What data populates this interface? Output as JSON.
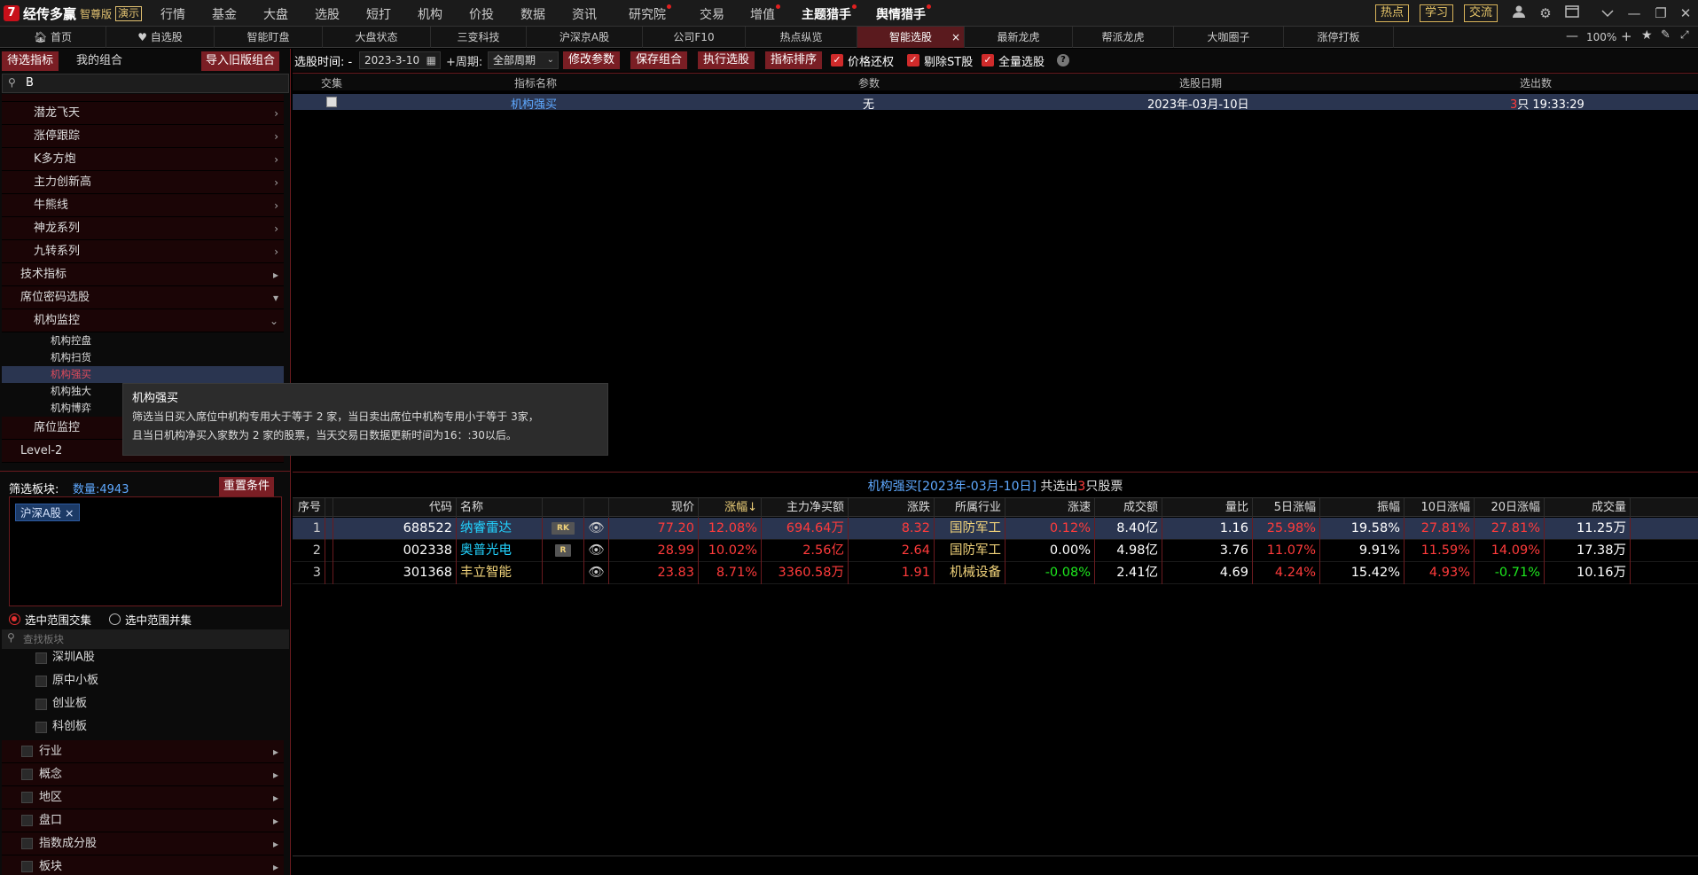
{
  "app": {
    "logo_mark": "7",
    "name": "经传多赢",
    "edition": "智尊版",
    "demo": "演示"
  },
  "top_menu": [
    "行情",
    "基金",
    "大盘",
    "选股",
    "短打",
    "机构",
    "价投",
    "数据",
    "资讯",
    "研究院",
    "交易",
    "增值",
    "主题猎手",
    "舆情猎手"
  ],
  "top_buttons": [
    "热点",
    "学习",
    "交流"
  ],
  "tabs": [
    "首页",
    "自选股",
    "智能盯盘",
    "大盘状态",
    "三变科技",
    "沪深京A股",
    "公司F10",
    "热点纵览",
    "智能选股",
    "最新龙虎",
    "帮派龙虎",
    "大咖圈子",
    "涨停打板"
  ],
  "zoom": "100%",
  "left_panel": {
    "tab_pending": "待选指标",
    "tab_mine": "我的组合",
    "import_btn": "导入旧版组合",
    "search_value": "B",
    "tree_top": [
      "潜龙飞天",
      "涨停跟踪",
      "K多方炮",
      "主力创新高",
      "牛熊线",
      "神龙系列",
      "九转系列"
    ],
    "tech": "技术指标",
    "seat_code": "席位密码选股",
    "inst_monitor": "机构监控",
    "inst_items": [
      "机构控盘",
      "机构扫货",
      "机构强买",
      "机构独大",
      "机构博弈"
    ],
    "seat_monitor": "席位监控",
    "level2": "Level-2",
    "filter_label": "筛选板块:",
    "count_label": "数量:4943",
    "reset_btn": "重置条件",
    "chip": "沪深A股",
    "radio_intersect": "选中范围交集",
    "radio_union": "选中范围并集",
    "board_search_placeholder": "查找板块",
    "boards": [
      "深圳A股",
      "原中小板",
      "创业板",
      "科创板"
    ],
    "categories": [
      "行业",
      "概念",
      "地区",
      "盘口",
      "指数成分股",
      "板块"
    ]
  },
  "tooltip": {
    "title": "机构强买",
    "line1": "筛选当日买入席位中机构专用大于等于 2 家，当日卖出席位中机构专用小于等于 3家，",
    "line2": "且当日机构净买入家数为 2 家的股票，当天交易日数据更新时间为16：:30以后。"
  },
  "controls": {
    "time_label": "选股时间: -",
    "date": "2023-3-10",
    "period_label": "+周期:",
    "period_value": "全部周期",
    "btn_modify": "修改参数",
    "btn_save": "保存组合",
    "btn_execute": "执行选股",
    "btn_sort": "指标排序",
    "chk_price": "价格还权",
    "chk_st": "剔除ST股",
    "chk_all": "全量选股",
    "help": "?"
  },
  "upper_table": {
    "headers": [
      "交集",
      "指标名称",
      "参数",
      "选股日期",
      "选出数"
    ],
    "row": {
      "name": "机构强买",
      "param": "无",
      "date": "2023年-03月-10日",
      "count": "3",
      "count_tail": "只 19:33:29"
    }
  },
  "result": {
    "title": "机构强买[2023年-03月-10日]",
    "mid": "共选出",
    "count": "3",
    "tail": "只股票"
  },
  "table_headers": [
    "序号",
    "代码",
    "名称",
    "",
    "",
    "现价",
    "涨幅↓",
    "主力净买额",
    "涨跌",
    "所属行业",
    "涨速",
    "成交额",
    "量比",
    "5日涨幅",
    "振幅",
    "10日涨幅",
    "20日涨幅",
    "成交量"
  ],
  "rows": [
    {
      "idx": "1",
      "code": "688522",
      "name": "纳睿雷达",
      "badge": "RK",
      "price": "77.20",
      "chg": "12.08%",
      "net": "694.64万",
      "up": "8.32",
      "ind": "国防军工",
      "speed": "0.12%",
      "amt": "8.40亿",
      "vr": "1.16",
      "d5": "25.98%",
      "amp": "19.58%",
      "d10": "27.81%",
      "d20": "27.81%",
      "vol": "11.25万"
    },
    {
      "idx": "2",
      "code": "002338",
      "name": "奥普光电",
      "badge": "R",
      "price": "28.99",
      "chg": "10.02%",
      "net": "2.56亿",
      "up": "2.64",
      "ind": "国防军工",
      "speed": "0.00%",
      "amt": "4.98亿",
      "vr": "3.76",
      "d5": "11.07%",
      "amp": "9.91%",
      "d10": "11.59%",
      "d20": "14.09%",
      "vol": "17.38万"
    },
    {
      "idx": "3",
      "code": "301368",
      "name": "丰立智能",
      "badge": "",
      "price": "23.83",
      "chg": "8.71%",
      "net": "3360.58万",
      "up": "1.91",
      "ind": "机械设备",
      "speed": "-0.08%",
      "amt": "2.41亿",
      "vr": "4.69",
      "d5": "4.24%",
      "amp": "15.42%",
      "d10": "4.93%",
      "d20": "-0.71%",
      "vol": "10.16万"
    }
  ]
}
